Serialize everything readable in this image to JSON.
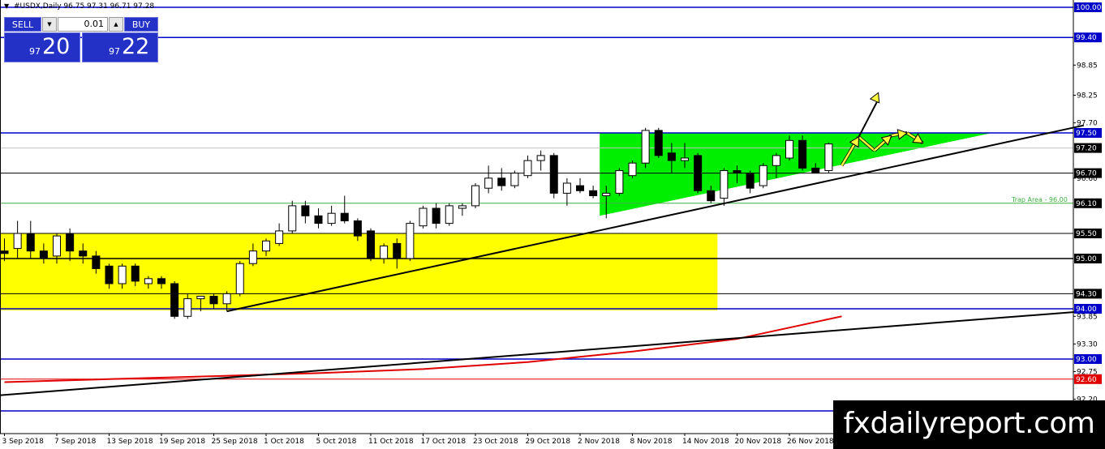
{
  "header": {
    "symbol_line": "#USDX,Daily  96.75 97.31 96.71 97.28"
  },
  "trade_panel": {
    "sell_label": "SELL",
    "buy_label": "BUY",
    "lot_value": "0.01",
    "sell_price_small": "97",
    "sell_price_big": "20",
    "buy_price_small": "97",
    "buy_price_big": "22"
  },
  "watermark": "fxdailyreport.com",
  "colors": {
    "accent_blue": "#2431c7",
    "level_blue": "#0000c8",
    "zone_yellow": "#ffff00",
    "triangle_green": "#00ee00",
    "moving_average_red": "#e00000",
    "trap_area_green": "#3cb043",
    "arrow_yellow": "#ffff3c"
  },
  "chart_data": {
    "type": "candlestick",
    "symbol": "#USDX",
    "timeframe": "Daily",
    "ylim": [
      92.2,
      100.2
    ],
    "price_labels": [
      "98.85",
      "98.25",
      "97.70",
      "96.60",
      "93.85",
      "93.30",
      "92.75",
      "92.20"
    ],
    "x_tick_labels": [
      "3 Sep 2018",
      "7 Sep 2018",
      "13 Sep 2018",
      "19 Sep 2018",
      "25 Sep 2018",
      "1 Oct 2018",
      "5 Oct 2018",
      "11 Oct 2018",
      "17 Oct 2018",
      "23 Oct 2018",
      "29 Oct 2018",
      "2 Nov 2018",
      "8 Nov 2018",
      "14 Nov 2018",
      "20 Nov 2018",
      "26 Nov 2018"
    ],
    "levels": [
      {
        "price": 100.0,
        "label": "100.00",
        "color": "#0000c8",
        "width": 1.5,
        "badge": "#0000c8"
      },
      {
        "price": 99.4,
        "label": "99.40",
        "color": "#0000c8",
        "width": 1.5,
        "badge": "#0000c8"
      },
      {
        "price": 97.5,
        "label": "97.50",
        "color": "#0000c8",
        "width": 1.5,
        "badge": "#0000c8"
      },
      {
        "price": 97.2,
        "label": "97.20",
        "color": "#c0c0c0",
        "width": 1,
        "badge": "#000000"
      },
      {
        "price": 96.7,
        "label": "96.70",
        "color": "#000000",
        "width": 1,
        "badge": "#000000"
      },
      {
        "price": 96.1,
        "label": "96.10",
        "color": "#3cb043",
        "width": 1,
        "badge": "#000000"
      },
      {
        "price": 95.5,
        "label": "95.50",
        "color": "#000000",
        "width": 1,
        "badge": "#000000"
      },
      {
        "price": 95.0,
        "label": "95.00",
        "color": "#000000",
        "width": 1.5,
        "badge": "#000000"
      },
      {
        "price": 94.3,
        "label": "94.30",
        "color": "#000000",
        "width": 1,
        "badge": "#000000"
      },
      {
        "price": 94.0,
        "label": "94.00",
        "color": "#0000c8",
        "width": 1.5,
        "badge": "#0000c8"
      },
      {
        "price": 93.0,
        "label": "93.00",
        "color": "#0000c8",
        "width": 1.5,
        "badge": "#0000c8"
      },
      {
        "price": 92.6,
        "label": "92.60",
        "color": "#e00000",
        "width": 1,
        "badge": "#e00000"
      }
    ],
    "annotations": {
      "trap_area_label": "Trap Area - 96.00"
    },
    "candles": [
      {
        "o": 95.15,
        "h": 95.4,
        "l": 94.95,
        "c": 95.1
      },
      {
        "o": 95.2,
        "h": 95.75,
        "l": 95.0,
        "c": 95.5
      },
      {
        "o": 95.5,
        "h": 95.75,
        "l": 95.0,
        "c": 95.15
      },
      {
        "o": 95.15,
        "h": 95.3,
        "l": 94.9,
        "c": 95.0
      },
      {
        "o": 95.05,
        "h": 95.5,
        "l": 94.9,
        "c": 95.45
      },
      {
        "o": 95.5,
        "h": 95.6,
        "l": 94.95,
        "c": 95.15
      },
      {
        "o": 95.15,
        "h": 95.3,
        "l": 94.9,
        "c": 95.05
      },
      {
        "o": 95.05,
        "h": 95.15,
        "l": 94.7,
        "c": 94.8
      },
      {
        "o": 94.85,
        "h": 94.9,
        "l": 94.4,
        "c": 94.5
      },
      {
        "o": 94.5,
        "h": 94.9,
        "l": 94.4,
        "c": 94.85
      },
      {
        "o": 94.85,
        "h": 94.9,
        "l": 94.45,
        "c": 94.55
      },
      {
        "o": 94.5,
        "h": 94.65,
        "l": 94.4,
        "c": 94.6
      },
      {
        "o": 94.6,
        "h": 94.65,
        "l": 94.4,
        "c": 94.5
      },
      {
        "o": 94.5,
        "h": 94.55,
        "l": 93.8,
        "c": 93.85
      },
      {
        "o": 93.85,
        "h": 94.3,
        "l": 93.8,
        "c": 94.2
      },
      {
        "o": 94.2,
        "h": 94.25,
        "l": 93.95,
        "c": 94.25
      },
      {
        "o": 94.25,
        "h": 94.3,
        "l": 94.0,
        "c": 94.1
      },
      {
        "o": 94.1,
        "h": 94.35,
        "l": 93.95,
        "c": 94.3
      },
      {
        "o": 94.3,
        "h": 94.95,
        "l": 94.25,
        "c": 94.9
      },
      {
        "o": 94.9,
        "h": 95.3,
        "l": 94.85,
        "c": 95.15
      },
      {
        "o": 95.15,
        "h": 95.4,
        "l": 95.05,
        "c": 95.35
      },
      {
        "o": 95.3,
        "h": 95.7,
        "l": 95.25,
        "c": 95.55
      },
      {
        "o": 95.55,
        "h": 96.15,
        "l": 95.5,
        "c": 96.05
      },
      {
        "o": 96.05,
        "h": 96.15,
        "l": 95.7,
        "c": 95.85
      },
      {
        "o": 95.85,
        "h": 96.0,
        "l": 95.6,
        "c": 95.7
      },
      {
        "o": 95.7,
        "h": 96.05,
        "l": 95.65,
        "c": 95.9
      },
      {
        "o": 95.9,
        "h": 96.25,
        "l": 95.7,
        "c": 95.75
      },
      {
        "o": 95.75,
        "h": 95.8,
        "l": 95.35,
        "c": 95.45
      },
      {
        "o": 95.55,
        "h": 95.6,
        "l": 94.95,
        "c": 95.0
      },
      {
        "o": 95.0,
        "h": 95.3,
        "l": 94.9,
        "c": 95.25
      },
      {
        "o": 95.3,
        "h": 95.4,
        "l": 94.8,
        "c": 95.0
      },
      {
        "o": 95.0,
        "h": 95.75,
        "l": 94.95,
        "c": 95.7
      },
      {
        "o": 95.65,
        "h": 96.05,
        "l": 95.6,
        "c": 96.0
      },
      {
        "o": 96.0,
        "h": 96.1,
        "l": 95.6,
        "c": 95.7
      },
      {
        "o": 95.7,
        "h": 96.1,
        "l": 95.65,
        "c": 96.05
      },
      {
        "o": 96.0,
        "h": 96.1,
        "l": 95.85,
        "c": 96.05
      },
      {
        "o": 96.05,
        "h": 96.5,
        "l": 96.0,
        "c": 96.45
      },
      {
        "o": 96.4,
        "h": 96.85,
        "l": 96.3,
        "c": 96.6
      },
      {
        "o": 96.6,
        "h": 96.8,
        "l": 96.35,
        "c": 96.45
      },
      {
        "o": 96.45,
        "h": 96.75,
        "l": 96.4,
        "c": 96.7
      },
      {
        "o": 96.65,
        "h": 97.05,
        "l": 96.6,
        "c": 96.95
      },
      {
        "o": 96.95,
        "h": 97.15,
        "l": 96.75,
        "c": 97.05
      },
      {
        "o": 97.05,
        "h": 97.1,
        "l": 96.2,
        "c": 96.3
      },
      {
        "o": 96.3,
        "h": 96.6,
        "l": 96.05,
        "c": 96.5
      },
      {
        "o": 96.45,
        "h": 96.6,
        "l": 96.3,
        "c": 96.35
      },
      {
        "o": 96.35,
        "h": 96.45,
        "l": 96.2,
        "c": 96.25
      },
      {
        "o": 96.25,
        "h": 96.45,
        "l": 95.8,
        "c": 96.3
      },
      {
        "o": 96.3,
        "h": 96.8,
        "l": 96.25,
        "c": 96.75
      },
      {
        "o": 96.65,
        "h": 96.95,
        "l": 96.6,
        "c": 96.9
      },
      {
        "o": 96.9,
        "h": 97.6,
        "l": 96.8,
        "c": 97.55
      },
      {
        "o": 97.55,
        "h": 97.6,
        "l": 97.0,
        "c": 97.05
      },
      {
        "o": 97.1,
        "h": 97.3,
        "l": 96.7,
        "c": 96.95
      },
      {
        "o": 96.95,
        "h": 97.3,
        "l": 96.8,
        "c": 97.0
      },
      {
        "o": 97.05,
        "h": 97.1,
        "l": 96.3,
        "c": 96.35
      },
      {
        "o": 96.35,
        "h": 96.45,
        "l": 96.1,
        "c": 96.15
      },
      {
        "o": 96.2,
        "h": 96.8,
        "l": 96.05,
        "c": 96.75
      },
      {
        "o": 96.75,
        "h": 96.85,
        "l": 96.5,
        "c": 96.7
      },
      {
        "o": 96.7,
        "h": 96.75,
        "l": 96.3,
        "c": 96.4
      },
      {
        "o": 96.45,
        "h": 96.9,
        "l": 96.4,
        "c": 96.85
      },
      {
        "o": 96.85,
        "h": 97.1,
        "l": 96.6,
        "c": 97.05
      },
      {
        "o": 97.0,
        "h": 97.45,
        "l": 96.95,
        "c": 97.35
      },
      {
        "o": 97.35,
        "h": 97.45,
        "l": 96.75,
        "c": 96.8
      },
      {
        "o": 96.8,
        "h": 96.9,
        "l": 96.7,
        "c": 96.7
      },
      {
        "o": 96.75,
        "h": 97.31,
        "l": 96.71,
        "c": 97.28
      }
    ],
    "moving_average": [
      [
        0,
        92.54
      ],
      [
        8,
        92.6
      ],
      [
        16,
        92.66
      ],
      [
        24,
        92.72
      ],
      [
        32,
        92.8
      ],
      [
        40,
        92.94
      ],
      [
        48,
        93.15
      ],
      [
        56,
        93.4
      ],
      [
        64,
        93.85
      ]
    ],
    "trend_lines": [
      {
        "from": [
          -0.3,
          92.28
        ],
        "to": [
          82.5,
          93.95
        ]
      },
      {
        "from": [
          17,
          93.95
        ],
        "to": [
          82.5,
          97.65
        ]
      }
    ],
    "yellow_zone": {
      "x0": -0.3,
      "x1": 54.5,
      "y0": 93.97,
      "y1": 95.5
    },
    "green_triangle": [
      [
        45.5,
        97.5
      ],
      [
        45.5,
        95.85
      ],
      [
        75.5,
        97.5
      ]
    ],
    "projection_path": [
      [
        64,
        96.85
      ],
      [
        65.3,
        97.42
      ],
      [
        66.5,
        97.15
      ],
      [
        67.8,
        97.45
      ],
      [
        69,
        97.5
      ],
      [
        70.2,
        97.3
      ]
    ],
    "breakout_arrow": {
      "from": [
        65.3,
        97.42
      ],
      "to": [
        66.8,
        98.3
      ]
    }
  }
}
